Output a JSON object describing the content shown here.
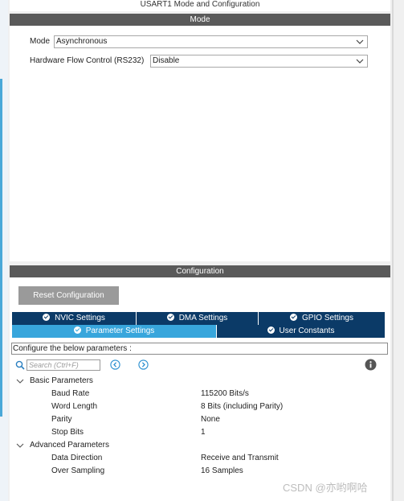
{
  "window": {
    "title": "USART1 Mode and Configuration"
  },
  "mode_section": {
    "header": "Mode",
    "fields": [
      {
        "label": "Mode",
        "value": "Asynchronous"
      },
      {
        "label": "Hardware Flow Control (RS232)",
        "value": "Disable"
      }
    ]
  },
  "config_section": {
    "header": "Configuration",
    "reset_label": "Reset Configuration",
    "tabs_row1": [
      {
        "label": "NVIC Settings"
      },
      {
        "label": "DMA Settings"
      },
      {
        "label": "GPIO Settings"
      }
    ],
    "tabs_row2": [
      {
        "label": "Parameter Settings",
        "active": true
      },
      {
        "label": "User Constants"
      }
    ],
    "hint": "Configure the below parameters :",
    "search": {
      "placeholder": "Search (Ctrl+F)"
    },
    "groups": [
      {
        "name": "Basic Parameters",
        "params": [
          {
            "name": "Baud Rate",
            "value": "115200 Bits/s"
          },
          {
            "name": "Word Length",
            "value": "8 Bits (including Parity)"
          },
          {
            "name": "Parity",
            "value": "None"
          },
          {
            "name": "Stop Bits",
            "value": "1"
          }
        ]
      },
      {
        "name": "Advanced Parameters",
        "params": [
          {
            "name": "Data Direction",
            "value": "Receive and Transmit"
          },
          {
            "name": "Over Sampling",
            "value": "16 Samples"
          }
        ]
      }
    ]
  },
  "watermark": "CSDN @亦哟啊哈",
  "colors": {
    "tab_dark": "#0b3a67",
    "tab_active": "#38a6dc",
    "header_bg": "#5a5a5a",
    "reset_bg": "#9a9a9a"
  }
}
